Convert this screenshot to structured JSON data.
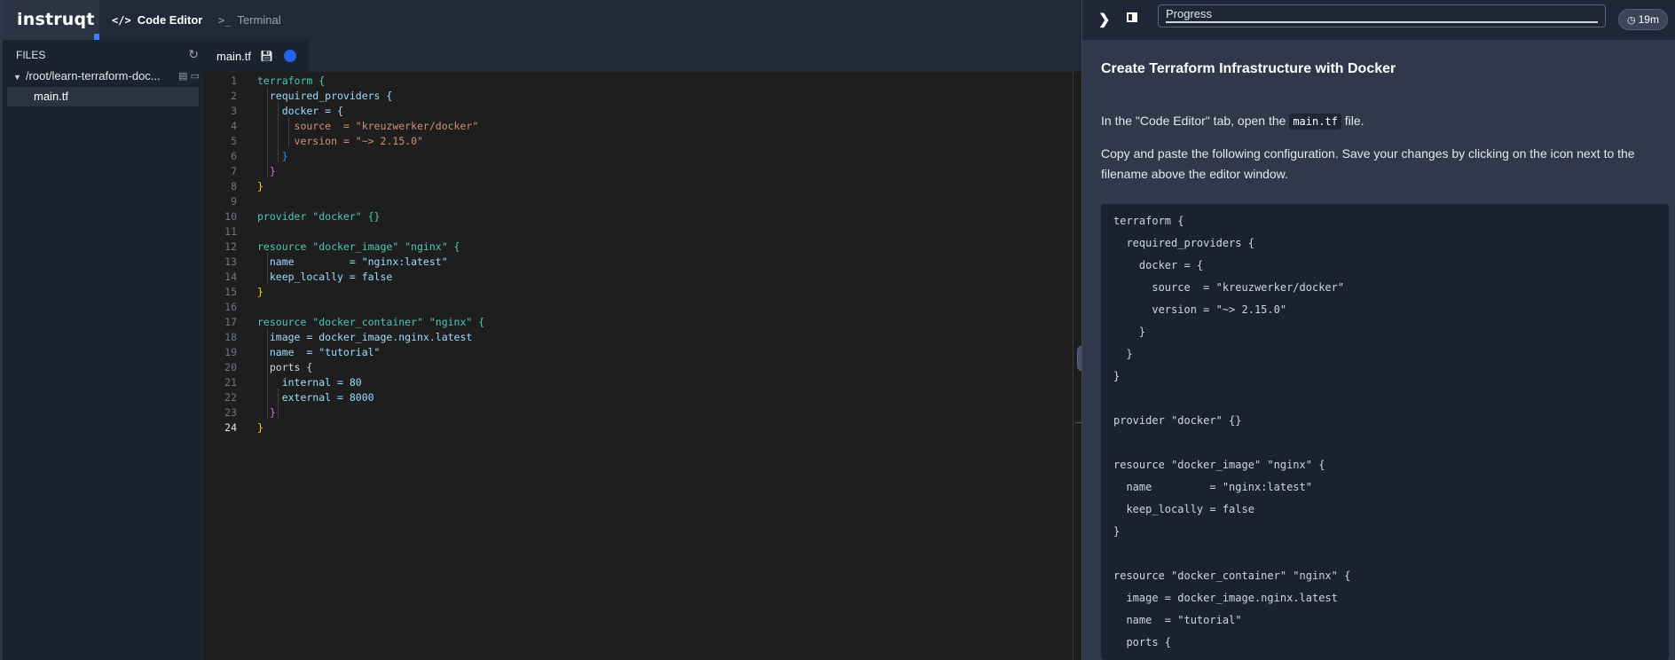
{
  "brand": {
    "logo": "instruqt"
  },
  "tabs": {
    "code_editor": {
      "icon": "</>",
      "label": "Code Editor"
    },
    "terminal": {
      "icon": ">_",
      "label": "Terminal"
    }
  },
  "files_panel": {
    "header": "FILES",
    "folder": "/root/learn-terraform-doc...",
    "file": "main.tf"
  },
  "editor": {
    "active_file": "main.tf",
    "current_line": 24,
    "lines": [
      "terraform {",
      "  required_providers {",
      "    docker = {",
      "      source  = \"kreuzwerker/docker\"",
      "      version = \"~> 2.15.0\"",
      "    }",
      "  }",
      "}",
      "",
      "provider \"docker\" {}",
      "",
      "resource \"docker_image\" \"nginx\" {",
      "  name         = \"nginx:latest\"",
      "  keep_locally = false",
      "}",
      "",
      "resource \"docker_container\" \"nginx\" {",
      "  image = docker_image.nginx.latest",
      "  name  = \"tutorial\"",
      "  ports {",
      "    internal = 80",
      "    external = 8000",
      "  }",
      "}"
    ]
  },
  "panel": {
    "progress_label": "Progress",
    "timer": "19m",
    "title": "Create Terraform Infrastructure with Docker",
    "para1_before": "In the \"Code Editor\" tab, open the ",
    "para1_code": "main.tf",
    "para1_after": " file.",
    "para2": "Copy and paste the following configuration. Save your changes by clicking on the icon next to the filename above the editor window.",
    "code_lines": [
      "terraform {",
      "  required_providers {",
      "    docker = {",
      "      source  = \"kreuzwerker/docker\"",
      "      version = \"~> 2.15.0\"",
      "    }",
      "  }",
      "}",
      "",
      "provider \"docker\" {}",
      "",
      "resource \"docker_image\" \"nginx\" {",
      "  name         = \"nginx:latest\"",
      "  keep_locally = false",
      "}",
      "",
      "resource \"docker_container\" \"nginx\" {",
      "  image = docker_image.nginx.latest",
      "  name  = \"tutorial\"",
      "  ports {"
    ]
  }
}
